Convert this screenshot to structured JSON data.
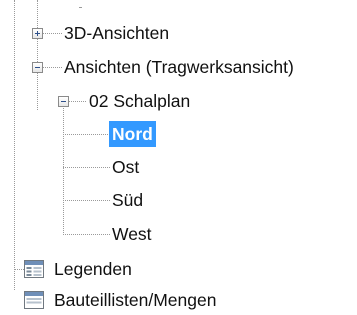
{
  "tree": {
    "views_3d": {
      "label": "3D-Ansichten",
      "expanded": false
    },
    "views_structural": {
      "label": "Ansichten (Tragwerksansicht)",
      "expanded": true
    },
    "schalplan": {
      "label": "02 Schalplan",
      "expanded": true
    },
    "children": [
      {
        "label": "Nord",
        "selected": true
      },
      {
        "label": "Ost",
        "selected": false
      },
      {
        "label": "Süd",
        "selected": false
      },
      {
        "label": "West",
        "selected": false
      }
    ],
    "legends": {
      "label": "Legenden",
      "icon": "table-icon"
    },
    "schedules": {
      "label": "Bauteillisten/Mengen",
      "icon": "table-icon"
    }
  },
  "colors": {
    "selection": "#3399ff",
    "tree_line": "#9a9a9a",
    "toggle_sign": "#2d4f8a"
  }
}
